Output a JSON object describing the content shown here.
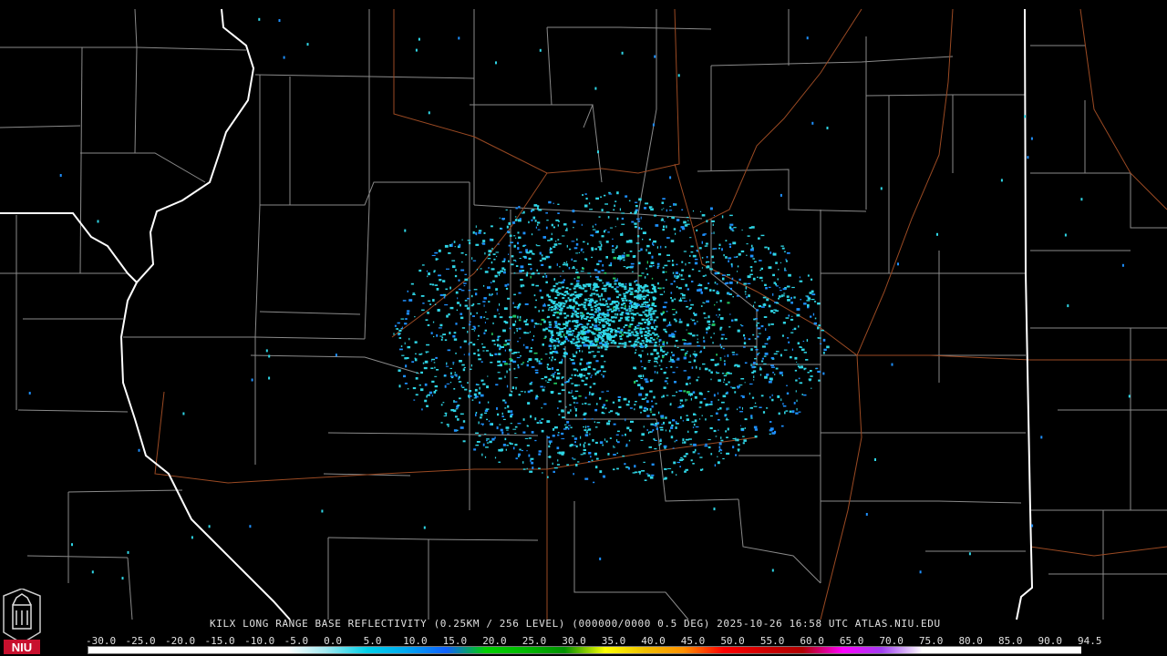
{
  "product": {
    "title": "KILX LONG RANGE BASE REFLECTIVITY (0.25KM / 256 LEVEL) (000000/0000 0.5 DEG) 2025-10-26 16:58 UTC  ATLAS.NIU.EDU"
  },
  "logo": {
    "text": "NIU",
    "color": "#c8102e"
  },
  "colors": {
    "background": "#000000",
    "county_lines": "#9a9a9a",
    "state_lines": "#ffffff",
    "highways": "#a0522d",
    "echo_primary": "#2fd6e6",
    "echo_secondary": "#1e90ff",
    "echo_strong": "#22c55e"
  },
  "legend": {
    "labels": [
      "-30.0",
      "-25.0",
      "-20.0",
      "-15.0",
      "-10.0",
      "-5.0",
      "0.0",
      "5.0",
      "10.0",
      "15.0",
      "20.0",
      "25.0",
      "30.0",
      "35.0",
      "40.0",
      "45.0",
      "50.0",
      "55.0",
      "60.0",
      "65.0",
      "70.0",
      "75.0",
      "80.0",
      "85.0",
      "90.0",
      "94.5"
    ],
    "colors": [
      "#ffffff",
      "#ffffff",
      "#ffffff",
      "#ffffff",
      "#ffffff",
      "#ffffff",
      "#9ee8f0",
      "#00d0e8",
      "#00a8f0",
      "#1060ff",
      "#00d000",
      "#00b800",
      "#009000",
      "#ffff00",
      "#f0c000",
      "#ff9000",
      "#ff0000",
      "#d00000",
      "#b00000",
      "#ff00ff",
      "#a040f0",
      "#ffffff",
      "#ffffff",
      "#ffffff",
      "#ffffff",
      "#ffffff"
    ]
  }
}
